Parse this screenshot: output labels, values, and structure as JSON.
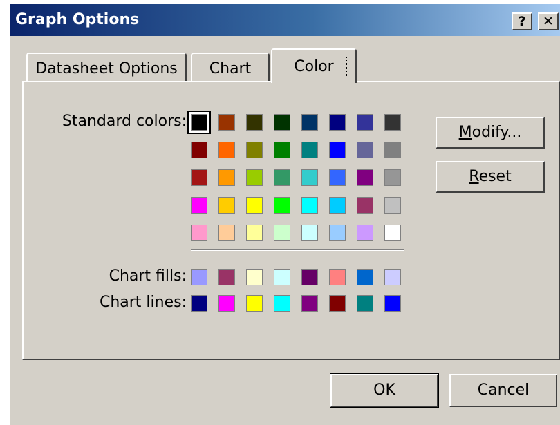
{
  "window": {
    "title": "Graph Options",
    "help_glyph": "?",
    "close_glyph": "✕"
  },
  "tabs": [
    {
      "label": "Datasheet Options",
      "active": false
    },
    {
      "label": "Chart",
      "active": false
    },
    {
      "label": "Color",
      "active": true
    }
  ],
  "color_tab": {
    "standard_label": "Standard colors:",
    "fills_label": "Chart fills:",
    "lines_label": "Chart lines:",
    "standard_colors": [
      [
        "#000000",
        "#993300",
        "#333300",
        "#003300",
        "#003366",
        "#000080",
        "#333399",
        "#333333"
      ],
      [
        "#800000",
        "#ff6600",
        "#808000",
        "#008000",
        "#008080",
        "#0000ff",
        "#666699",
        "#808080"
      ],
      [
        "#a31515",
        "#ff9900",
        "#99cc00",
        "#339966",
        "#33cccc",
        "#3366ff",
        "#800080",
        "#969696"
      ],
      [
        "#ff00ff",
        "#ffcc00",
        "#ffff00",
        "#00ff00",
        "#00ffff",
        "#00ccff",
        "#993366",
        "#c0c0c0"
      ],
      [
        "#ff99cc",
        "#ffcc99",
        "#ffff99",
        "#ccffcc",
        "#ccffff",
        "#99ccff",
        "#cc99ff",
        "#ffffff"
      ]
    ],
    "selected_standard": "#000000",
    "chart_fills": [
      "#9999ff",
      "#993366",
      "#ffffcc",
      "#ccffff",
      "#660066",
      "#ff8080",
      "#0066cc",
      "#ccccff"
    ],
    "chart_lines": [
      "#000080",
      "#ff00ff",
      "#ffff00",
      "#00ffff",
      "#800080",
      "#800000",
      "#008080",
      "#0000ff"
    ]
  },
  "buttons": {
    "modify_mnemonic": "M",
    "modify_rest": "odify...",
    "reset_mnemonic": "R",
    "reset_rest": "eset",
    "ok": "OK",
    "cancel": "Cancel"
  }
}
